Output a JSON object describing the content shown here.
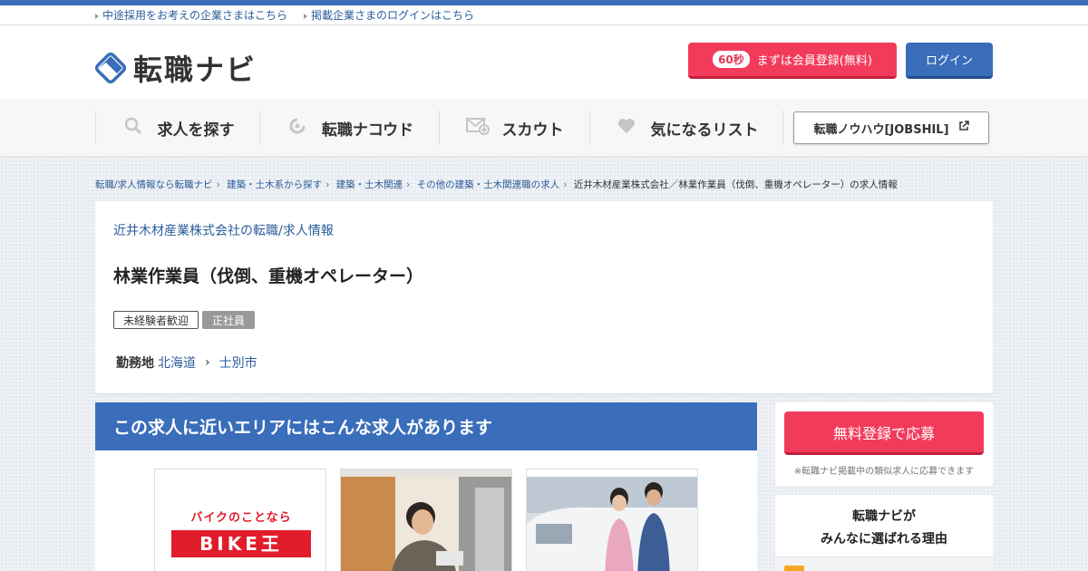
{
  "top_links": [
    "中途採用をお考えの企業さまはこちら",
    "掲載企業さまのログインはこちら"
  ],
  "logo": {
    "text": "転職ナビ"
  },
  "header": {
    "register_badge": "60秒",
    "register_label": "まずは会員登録(無料)",
    "login_label": "ログイン"
  },
  "nav": {
    "items": [
      {
        "label": "求人を探す",
        "icon": "search-icon"
      },
      {
        "label": "転職ナコウド",
        "icon": "nakoudo-icon"
      },
      {
        "label": "スカウト",
        "icon": "mail-icon"
      },
      {
        "label": "気になるリスト",
        "icon": "heart-icon"
      }
    ],
    "jobshil_label": "転職ノウハウ[JOBSHIL]"
  },
  "breadcrumb": [
    "転職/求人情報なら転職ナビ",
    "建築・土木系から探す",
    "建築・土木関連",
    "その他の建築・土木関連職の求人",
    "近井木材産業株式会社／林業作業員（伐倒、重機オペレーター）の求人情報"
  ],
  "job": {
    "company": "近井木材産業株式会社の転職/求人情報",
    "title": "林業作業員（伐倒、重機オペレーター）",
    "tags": [
      "未経験者歓迎",
      "正社員"
    ],
    "location_label": "勤務地",
    "prefecture": "北海道",
    "city": "士別市"
  },
  "nearby": {
    "heading": "この求人に近いエリアにはこんな求人があります",
    "logo_text_top": "バイクのことなら",
    "logo_text_main": "BIKE王"
  },
  "sidebar": {
    "apply_label": "無料登録で応募",
    "apply_note": "※転職ナビ掲載中の類似求人に応募できます",
    "reasons_line1": "転職ナビが",
    "reasons_line2": "みんなに選ばれる理由"
  },
  "colors": {
    "brand_blue": "#3a6dba",
    "accent_red": "#f23b5b",
    "link_blue": "#2b5d9b"
  }
}
